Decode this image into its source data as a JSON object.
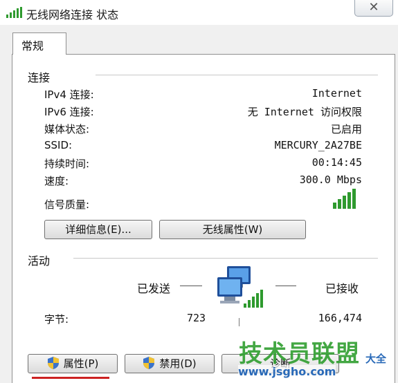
{
  "window": {
    "title": "无线网络连接 状态",
    "close_glyph": "✕"
  },
  "tabs": [
    {
      "label": "常规",
      "active": true
    }
  ],
  "connection": {
    "section_title": "连接",
    "rows": [
      {
        "label": "IPv4 连接:",
        "value": "Internet"
      },
      {
        "label": "IPv6 连接:",
        "value": "无 Internet 访问权限"
      },
      {
        "label": "媒体状态:",
        "value": "已启用"
      },
      {
        "label": "SSID:",
        "value": "MERCURY_2A27BE"
      },
      {
        "label": "持续时间:",
        "value": "00:14:45"
      },
      {
        "label": "速度:",
        "value": "300.0 Mbps"
      }
    ],
    "signal_label": "信号质量:",
    "signal_bars": 5,
    "details_button": "详细信息(E)...",
    "wireless_props_button": "无线属性(W)"
  },
  "activity": {
    "section_title": "活动",
    "sent_label": "已发送",
    "received_label": "已接收",
    "bytes_label": "字节:",
    "bytes_sent": "723",
    "bytes_received": "166,474"
  },
  "bottom_buttons": {
    "properties": "属性(P)",
    "disable": "禁用(D)",
    "diagnose": "诊断"
  },
  "watermark": {
    "brand": "技术员联盟",
    "side_text": "大全",
    "url": "www.jsgho.com"
  },
  "colors": {
    "signal_green": "#2e9a2e",
    "watermark_green": "#2f9e2f",
    "watermark_blue": "#2a6ab8",
    "underline_red": "#cc2222"
  }
}
